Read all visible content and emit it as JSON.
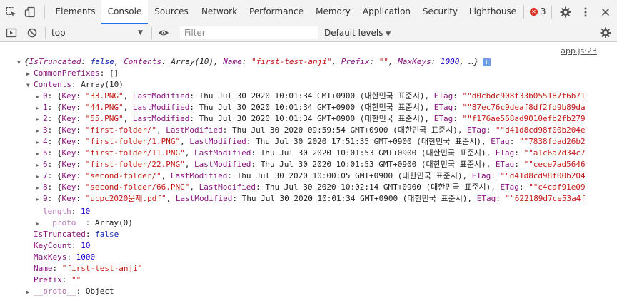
{
  "tabs": [
    "Elements",
    "Console",
    "Sources",
    "Network",
    "Performance",
    "Memory",
    "Application",
    "Security",
    "Lighthouse"
  ],
  "error_count": "3",
  "toolbar": {
    "context": "top",
    "filter_placeholder": "Filter",
    "levels": "Default levels"
  },
  "source_link": "app.js:23",
  "summary": {
    "open": "{",
    "k1": "IsTruncated",
    "v1": "false",
    "k2": "Contents",
    "v2": "Array(10)",
    "k3": "Name",
    "v3": "\"first-test-anji\"",
    "k4": "Prefix",
    "v4": "\"\"",
    "k5": "MaxKeys",
    "v5": "1000",
    "tail": ", …}"
  },
  "common_prefixes": {
    "key": "CommonPrefixes",
    "value": "[]"
  },
  "contents_header": {
    "key": "Contents",
    "value": "Array(10)"
  },
  "items": [
    {
      "idx": "0",
      "key": "\"33.PNG\"",
      "date": "Thu Jul 30 2020 10:01:34 GMT+0900 (대한민국 표준시)",
      "etag": "\"\"d0cbdc908f33b055187f6b71"
    },
    {
      "idx": "1",
      "key": "\"44.PNG\"",
      "date": "Thu Jul 30 2020 10:01:34 GMT+0900 (대한민국 표준시)",
      "etag": "\"\"87ec76c9deaf8df2fd9b89da"
    },
    {
      "idx": "2",
      "key": "\"55.PNG\"",
      "date": "Thu Jul 30 2020 10:01:34 GMT+0900 (대한민국 표준시)",
      "etag": "\"\"f176ae568ad9010efb2fb279"
    },
    {
      "idx": "3",
      "key": "\"first-folder/\"",
      "date": "Thu Jul 30 2020 09:59:54 GMT+0900 (대한민국 표준시)",
      "etag": "\"\"d41d8cd98f00b204e"
    },
    {
      "idx": "4",
      "key": "\"first-folder/1.PNG\"",
      "date": "Thu Jul 30 2020 17:51:35 GMT+0900 (대한민국 표준시)",
      "etag": "\"\"7838fdad26b2"
    },
    {
      "idx": "5",
      "key": "\"first-folder/11.PNG\"",
      "date": "Thu Jul 30 2020 10:01:53 GMT+0900 (대한민국 표준시)",
      "etag": "\"\"a1c6a7d34c7"
    },
    {
      "idx": "6",
      "key": "\"first-folder/22.PNG\"",
      "date": "Thu Jul 30 2020 10:01:53 GMT+0900 (대한민국 표준시)",
      "etag": "\"\"cece7ad5646"
    },
    {
      "idx": "7",
      "key": "\"second-folder/\"",
      "date": "Thu Jul 30 2020 10:00:05 GMT+0900 (대한민국 표준시)",
      "etag": "\"\"d41d8cd98f00b204"
    },
    {
      "idx": "8",
      "key": "\"second-folder/66.PNG\"",
      "date": "Thu Jul 30 2020 10:02:14 GMT+0900 (대한민국 표준시)",
      "etag": "\"\"c4caf91e09"
    },
    {
      "idx": "9",
      "key": "\"ucpc2020문제.pdf\"",
      "date": "Thu Jul 30 2020 10:01:34 GMT+0900 (대한민국 표준시)",
      "etag": "\"\"622189d7ce53a4f"
    }
  ],
  "item_labels": {
    "key": "Key",
    "lastmod": "LastModified",
    "etag": "ETag"
  },
  "length": {
    "key": "length",
    "value": "10"
  },
  "proto_array": {
    "key": "__proto__",
    "value": "Array(0)"
  },
  "props": [
    {
      "key": "IsTruncated",
      "value": "false",
      "type": "kw"
    },
    {
      "key": "KeyCount",
      "value": "10",
      "type": "num"
    },
    {
      "key": "MaxKeys",
      "value": "1000",
      "type": "num"
    },
    {
      "key": "Name",
      "value": "\"first-test-anji\"",
      "type": "str"
    },
    {
      "key": "Prefix",
      "value": "\"\"",
      "type": "str"
    }
  ],
  "proto_object": {
    "key": "__proto__",
    "value": "Object"
  },
  "colors": {
    "accent": "#1a73e8",
    "error": "#d93025",
    "key": "#881280",
    "string": "#c41a16",
    "number": "#1c00cf"
  }
}
